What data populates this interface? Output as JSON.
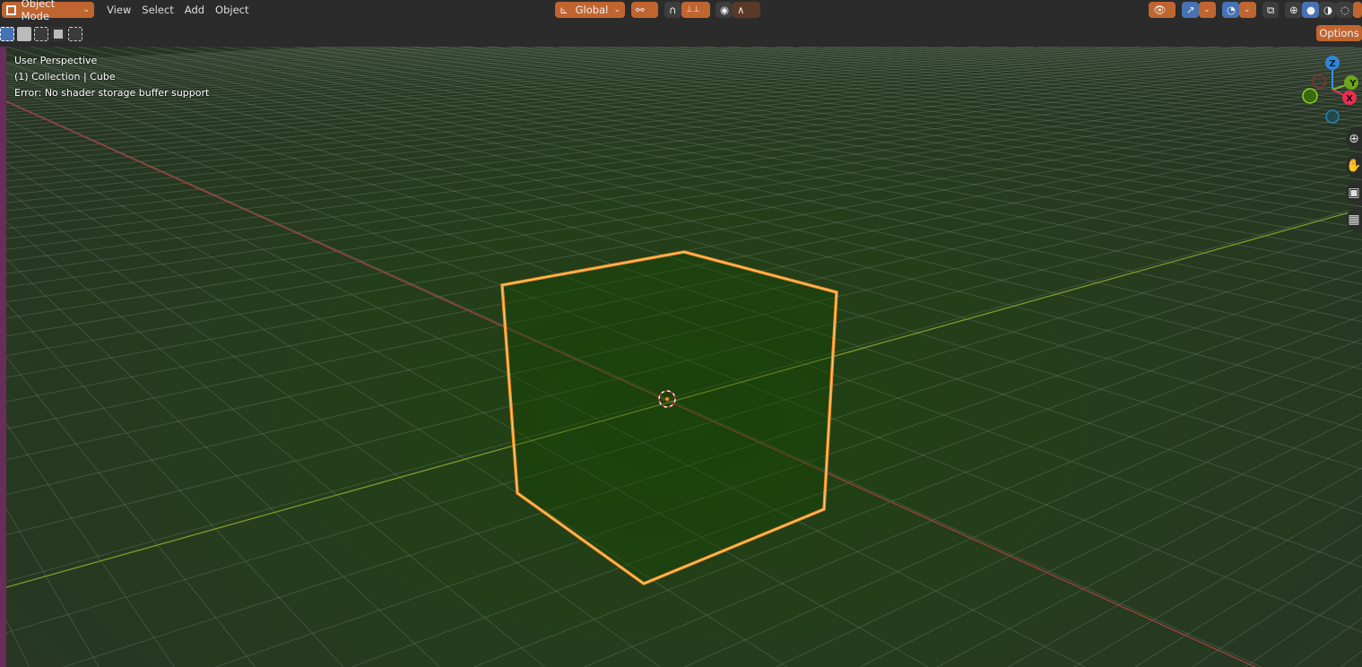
{
  "header": {
    "mode": "Object Mode",
    "menus": [
      "View",
      "Select",
      "Add",
      "Object"
    ],
    "orientation": "Global",
    "options": "Options"
  },
  "overlay": {
    "perspective": "User Perspective",
    "collection": "(1) Collection | Cube",
    "error": "Error: No shader storage buffer support"
  },
  "gizmo": {
    "x": "X",
    "y": "Y",
    "z": "Z"
  },
  "colors": {
    "accent": "#c06530",
    "active": "#4772b3",
    "x_axis": "#c8424a",
    "y_axis": "#8fb832",
    "selection": "#f38f1d"
  },
  "icons": {
    "select_modes": [
      "select-set",
      "select-extend",
      "select-subtract",
      "select-invert",
      "select-intersect"
    ],
    "nav": [
      "zoom-icon",
      "hand-pan-icon",
      "camera-icon",
      "grid-ortho-icon"
    ]
  }
}
